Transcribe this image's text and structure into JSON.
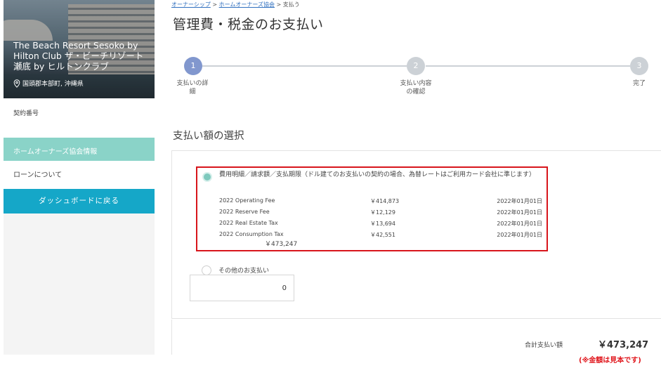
{
  "sidebar": {
    "property_name": "The Beach Resort Sesoko by Hilton Club ザ・ビーチリゾート瀬底 by ヒルトンクラブ",
    "location": "国頭郡本部町, 沖縄県",
    "contract_label": "契約番号",
    "menu_hoa": "ホームオーナーズ協会情報",
    "menu_loan": "ローンについて",
    "dashboard_button": "ダッシュボードに戻る"
  },
  "breadcrumb": {
    "item1": "オーナーシップ",
    "sep": ">",
    "item2": "ホームオーナーズ協会",
    "current": "支払う"
  },
  "page_title": "管理費・税金のお支払い",
  "stepper": {
    "steps": [
      {
        "number": "1",
        "label_line1": "支払いの詳",
        "label_line2": "細"
      },
      {
        "number": "2",
        "label_line1": "支払い内容",
        "label_line2": "の確認"
      },
      {
        "number": "3",
        "label_line1": "完了",
        "label_line2": ""
      }
    ],
    "active_color": "#8197ce",
    "inactive_color": "#ccd1d6"
  },
  "section_title": "支払い額の選択",
  "payment_option": {
    "label": "費用明細／請求額／支払期限（ドル建てのお支払いの契約の場合、為替レートはご利用カード会社に準じます）",
    "fees": [
      {
        "name": "2022 Operating Fee",
        "amount": "￥414,873",
        "due": "2022年01月01日"
      },
      {
        "name": "2022 Reserve Fee",
        "amount": "￥12,129",
        "due": "2022年01月01日"
      },
      {
        "name": "2022 Real Estate Tax",
        "amount": "￥13,694",
        "due": "2022年01月01日"
      },
      {
        "name": "2022 Consumption Tax",
        "amount": "￥42,551",
        "due": "2022年01月01日"
      }
    ],
    "subtotal": "￥473,247"
  },
  "other_payment": {
    "label": "その他のお支払い",
    "value": "0"
  },
  "total": {
    "label": "合計支払い額",
    "amount": "￥473,247"
  },
  "note": "(※金額は見本です)",
  "colors": {
    "hoa_menu": "#8ad3c8",
    "dashboard_button": "#15a7c8",
    "highlight_border": "#d8151b",
    "radio_selected": "#7ec9bd"
  }
}
